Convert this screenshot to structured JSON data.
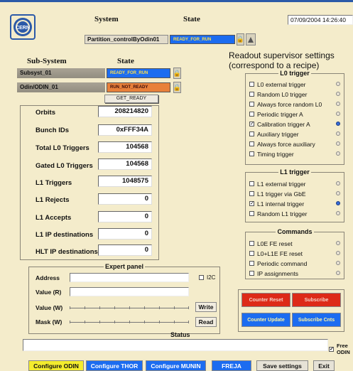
{
  "header": {
    "system_label": "System",
    "state_label": "State",
    "datetime": "07/09/2004 14:26:40",
    "partition": "Partition_controlByOdin01",
    "partition_state": "READY_FOR_RUN"
  },
  "subsystem_panel": {
    "col_subsystem": "Sub-System",
    "col_state": "State",
    "rows": [
      {
        "name": "Subsyst_01",
        "state": "READY_FOR_RUN"
      },
      {
        "name": "Odin/ODIN_01",
        "state": "RUN_NOT_READY"
      }
    ],
    "action": "GET_READY"
  },
  "title": {
    "line1": "Readout supervisor settings",
    "line2": "(correspond to a recipe)"
  },
  "counters": [
    {
      "label": "Orbits",
      "value": "208214820"
    },
    {
      "label": "Bunch IDs",
      "value": "0xFFF34A"
    },
    {
      "label": "Total L0 Triggers",
      "value": "104568"
    },
    {
      "label": "Gated L0 Triggers",
      "value": "104568"
    },
    {
      "label": "L1 Triggers",
      "value": "1048575"
    },
    {
      "label": "L1 Rejects",
      "value": "0"
    },
    {
      "label": "L1 Accepts",
      "value": "0"
    },
    {
      "label": "L1 IP destinations",
      "value": "0"
    },
    {
      "label": "HLT IP destinations",
      "value": "0"
    }
  ],
  "l0_trigger": {
    "title": "L0 trigger",
    "options": [
      {
        "label": "L0 external trigger",
        "checked": false,
        "active": false
      },
      {
        "label": "Random L0 trigger",
        "checked": false,
        "active": false
      },
      {
        "label": "Always force random L0",
        "checked": false,
        "active": false
      },
      {
        "label": "Periodic trigger A",
        "checked": false,
        "active": false
      },
      {
        "label": "Calibration trigger A",
        "checked": true,
        "active": true
      },
      {
        "label": "Auxiliary trigger",
        "checked": false,
        "active": false
      },
      {
        "label": "Always force auxiliary",
        "checked": false,
        "active": false
      },
      {
        "label": "Timing trigger",
        "checked": false,
        "active": false
      }
    ]
  },
  "l1_trigger": {
    "title": "L1 trigger",
    "options": [
      {
        "label": "L1 external trigger",
        "checked": false,
        "active": false
      },
      {
        "label": "L1 trigger via GbE",
        "checked": false,
        "active": false
      },
      {
        "label": "L1 internal trigger",
        "checked": true,
        "active": true
      },
      {
        "label": "Random L1 trigger",
        "checked": false,
        "active": false
      }
    ]
  },
  "commands": {
    "title": "Commands",
    "options": [
      {
        "label": "L0E FE reset",
        "checked": false,
        "active": false
      },
      {
        "label": "L0+L1E FE reset",
        "checked": false,
        "active": false
      },
      {
        "label": "Periodic command",
        "checked": false,
        "active": false
      },
      {
        "label": "IP assignments",
        "checked": false,
        "active": false
      }
    ]
  },
  "expert": {
    "title": "Expert panel",
    "address": "Address",
    "i2c": "I2C",
    "value_r": "Value (R)",
    "value_w": "Value (W)",
    "mask_w": "Mask (W)",
    "write": "Write",
    "read": "Read"
  },
  "action_buttons": {
    "counter_reset": "Counter Reset",
    "subscribe": "Subscribe",
    "counter_update": "Counter Update",
    "subscribe_cnts": "Subscribe Cnts"
  },
  "status": {
    "label": "Status",
    "free_odin": "Free ODIN",
    "free_odin_checked": true
  },
  "footer": {
    "configure_odin": "Configure ODIN",
    "configure_thor": "Configure THOR",
    "configure_munin": "Configure MUNIN",
    "freja": "FREJA",
    "save_settings": "Save settings",
    "exit": "Exit"
  }
}
